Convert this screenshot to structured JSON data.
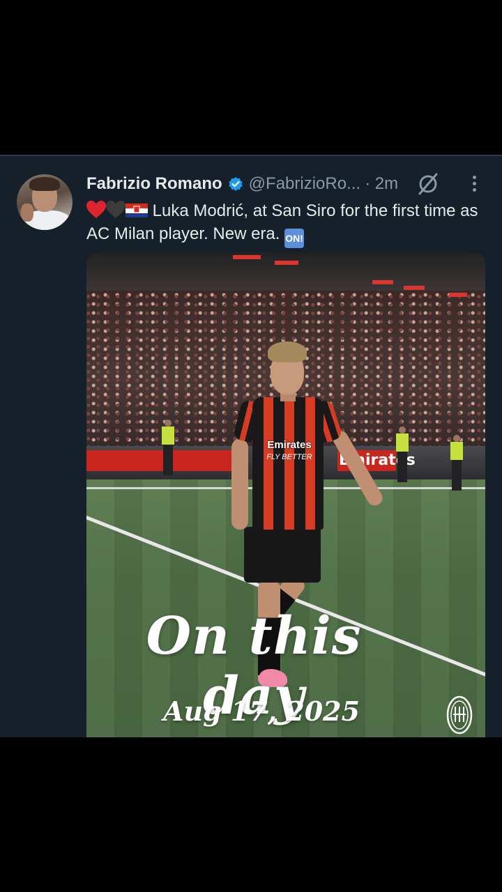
{
  "tweet": {
    "author_name": "Fabrizio Romano",
    "handle": "@FabrizioRo...",
    "time": "· 2m",
    "text": "Luka Modrić, at San Siro for the first time as AC Milan player. New era.",
    "emoji_icons": [
      "red-heart-icon",
      "black-heart-icon",
      "croatia-flag-icon"
    ],
    "end_emoji": "ON!"
  },
  "media": {
    "board_text": "Emirates",
    "sponsor": "Emirates",
    "sponsor_tagline": "FLY BETTER",
    "overlay_title": "On this day",
    "overlay_date": "Aug 17, 2025"
  }
}
